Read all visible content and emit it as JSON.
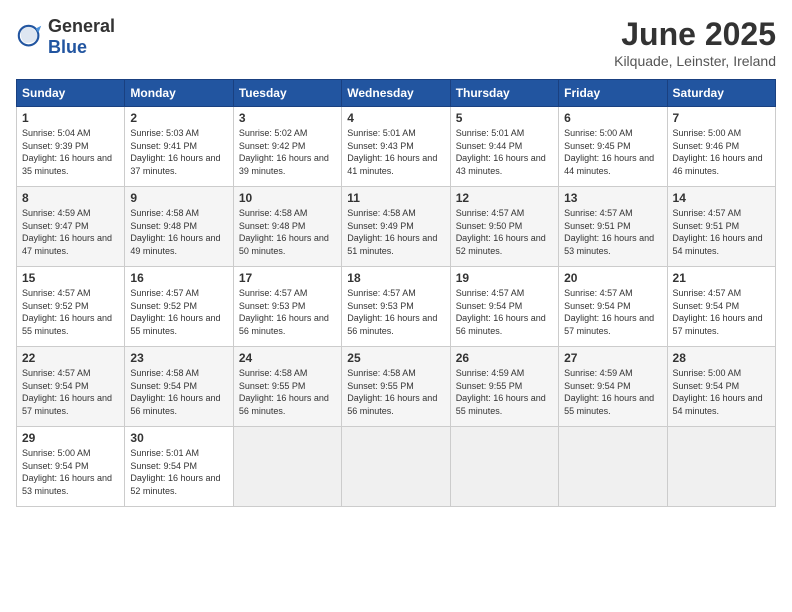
{
  "header": {
    "logo_general": "General",
    "logo_blue": "Blue",
    "month_year": "June 2025",
    "location": "Kilquade, Leinster, Ireland"
  },
  "days_of_week": [
    "Sunday",
    "Monday",
    "Tuesday",
    "Wednesday",
    "Thursday",
    "Friday",
    "Saturday"
  ],
  "weeks": [
    [
      {
        "day": "1",
        "sunrise": "5:04 AM",
        "sunset": "9:39 PM",
        "daylight": "16 hours and 35 minutes."
      },
      {
        "day": "2",
        "sunrise": "5:03 AM",
        "sunset": "9:41 PM",
        "daylight": "16 hours and 37 minutes."
      },
      {
        "day": "3",
        "sunrise": "5:02 AM",
        "sunset": "9:42 PM",
        "daylight": "16 hours and 39 minutes."
      },
      {
        "day": "4",
        "sunrise": "5:01 AM",
        "sunset": "9:43 PM",
        "daylight": "16 hours and 41 minutes."
      },
      {
        "day": "5",
        "sunrise": "5:01 AM",
        "sunset": "9:44 PM",
        "daylight": "16 hours and 43 minutes."
      },
      {
        "day": "6",
        "sunrise": "5:00 AM",
        "sunset": "9:45 PM",
        "daylight": "16 hours and 44 minutes."
      },
      {
        "day": "7",
        "sunrise": "5:00 AM",
        "sunset": "9:46 PM",
        "daylight": "16 hours and 46 minutes."
      }
    ],
    [
      {
        "day": "8",
        "sunrise": "4:59 AM",
        "sunset": "9:47 PM",
        "daylight": "16 hours and 47 minutes."
      },
      {
        "day": "9",
        "sunrise": "4:58 AM",
        "sunset": "9:48 PM",
        "daylight": "16 hours and 49 minutes."
      },
      {
        "day": "10",
        "sunrise": "4:58 AM",
        "sunset": "9:48 PM",
        "daylight": "16 hours and 50 minutes."
      },
      {
        "day": "11",
        "sunrise": "4:58 AM",
        "sunset": "9:49 PM",
        "daylight": "16 hours and 51 minutes."
      },
      {
        "day": "12",
        "sunrise": "4:57 AM",
        "sunset": "9:50 PM",
        "daylight": "16 hours and 52 minutes."
      },
      {
        "day": "13",
        "sunrise": "4:57 AM",
        "sunset": "9:51 PM",
        "daylight": "16 hours and 53 minutes."
      },
      {
        "day": "14",
        "sunrise": "4:57 AM",
        "sunset": "9:51 PM",
        "daylight": "16 hours and 54 minutes."
      }
    ],
    [
      {
        "day": "15",
        "sunrise": "4:57 AM",
        "sunset": "9:52 PM",
        "daylight": "16 hours and 55 minutes."
      },
      {
        "day": "16",
        "sunrise": "4:57 AM",
        "sunset": "9:52 PM",
        "daylight": "16 hours and 55 minutes."
      },
      {
        "day": "17",
        "sunrise": "4:57 AM",
        "sunset": "9:53 PM",
        "daylight": "16 hours and 56 minutes."
      },
      {
        "day": "18",
        "sunrise": "4:57 AM",
        "sunset": "9:53 PM",
        "daylight": "16 hours and 56 minutes."
      },
      {
        "day": "19",
        "sunrise": "4:57 AM",
        "sunset": "9:54 PM",
        "daylight": "16 hours and 56 minutes."
      },
      {
        "day": "20",
        "sunrise": "4:57 AM",
        "sunset": "9:54 PM",
        "daylight": "16 hours and 57 minutes."
      },
      {
        "day": "21",
        "sunrise": "4:57 AM",
        "sunset": "9:54 PM",
        "daylight": "16 hours and 57 minutes."
      }
    ],
    [
      {
        "day": "22",
        "sunrise": "4:57 AM",
        "sunset": "9:54 PM",
        "daylight": "16 hours and 57 minutes."
      },
      {
        "day": "23",
        "sunrise": "4:58 AM",
        "sunset": "9:54 PM",
        "daylight": "16 hours and 56 minutes."
      },
      {
        "day": "24",
        "sunrise": "4:58 AM",
        "sunset": "9:55 PM",
        "daylight": "16 hours and 56 minutes."
      },
      {
        "day": "25",
        "sunrise": "4:58 AM",
        "sunset": "9:55 PM",
        "daylight": "16 hours and 56 minutes."
      },
      {
        "day": "26",
        "sunrise": "4:59 AM",
        "sunset": "9:55 PM",
        "daylight": "16 hours and 55 minutes."
      },
      {
        "day": "27",
        "sunrise": "4:59 AM",
        "sunset": "9:54 PM",
        "daylight": "16 hours and 55 minutes."
      },
      {
        "day": "28",
        "sunrise": "5:00 AM",
        "sunset": "9:54 PM",
        "daylight": "16 hours and 54 minutes."
      }
    ],
    [
      {
        "day": "29",
        "sunrise": "5:00 AM",
        "sunset": "9:54 PM",
        "daylight": "16 hours and 53 minutes."
      },
      {
        "day": "30",
        "sunrise": "5:01 AM",
        "sunset": "9:54 PM",
        "daylight": "16 hours and 52 minutes."
      },
      null,
      null,
      null,
      null,
      null
    ]
  ]
}
